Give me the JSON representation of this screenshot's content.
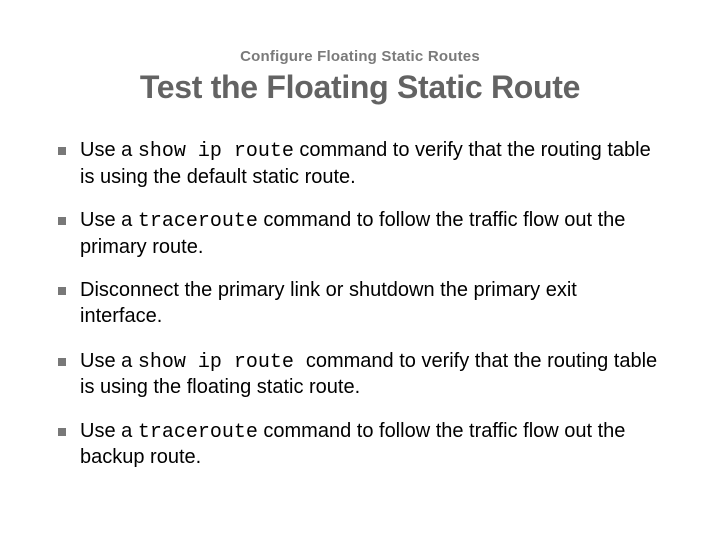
{
  "header": {
    "eyebrow": "Configure Floating Static Routes",
    "title": "Test the Floating Static Route"
  },
  "bullets": [
    {
      "pre": "Use a ",
      "code": "show ip route",
      "post": " command to verify that the routing table is using the default static route."
    },
    {
      "pre": "Use a ",
      "code": "traceroute",
      "post": " command to follow the traffic flow out the primary route."
    },
    {
      "pre": "Disconnect the primary link  or shutdown the primary exit interface.",
      "code": "",
      "post": ""
    },
    {
      "pre": "Use a ",
      "code": "show ip route ",
      "post": " command to verify that the routing table is using the floating static route."
    },
    {
      "pre": "Use a ",
      "code": "traceroute",
      "post": " command to follow the traffic flow out the backup route."
    }
  ]
}
